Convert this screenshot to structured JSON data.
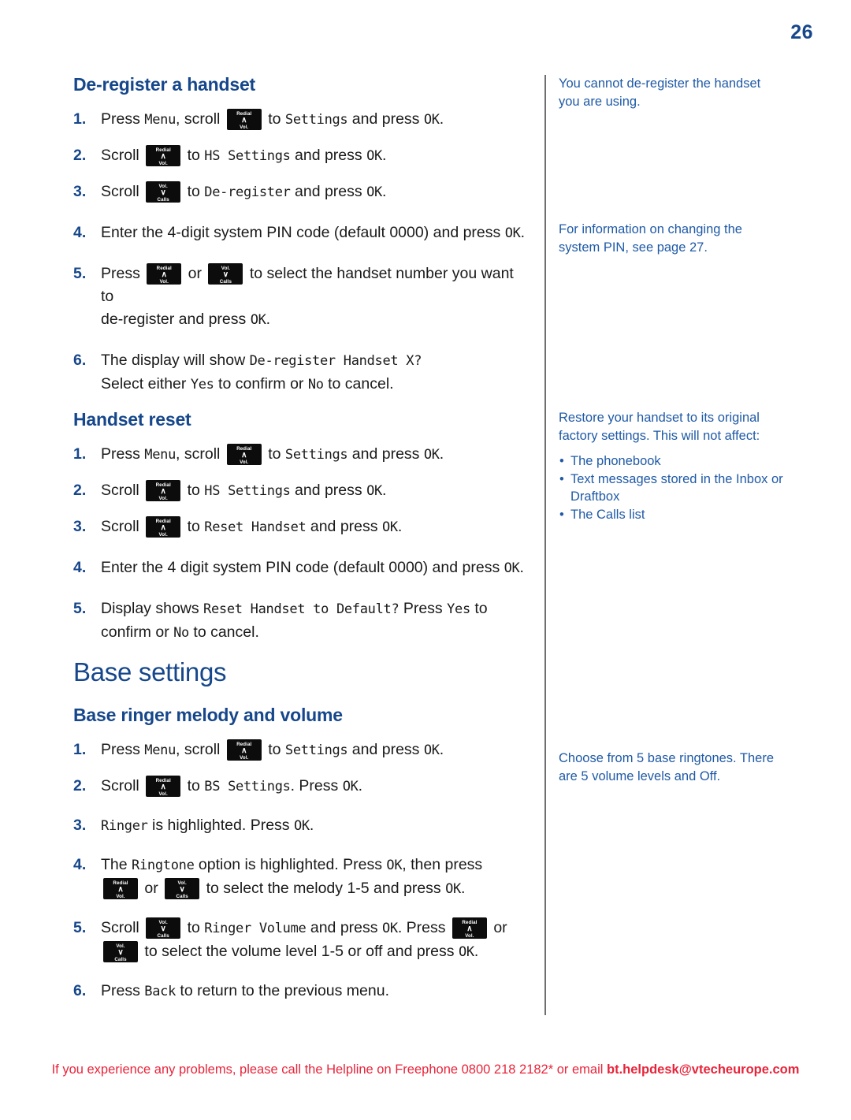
{
  "page": {
    "number": "26",
    "accent_blue": "#16478b",
    "note_blue": "#1f5aa6",
    "footer_red": "#e8243a"
  },
  "keys": {
    "up": {
      "top": "Redial",
      "arrow": "∧",
      "bottom": "Vol."
    },
    "down": {
      "top": "Vol.",
      "arrow": "∨",
      "bottom": "Calls"
    }
  },
  "sections": {
    "deregister": {
      "heading": "De-register a handset",
      "steps": {
        "s1": {
          "num": "1.",
          "a": "Press ",
          "m1": "Menu",
          "b": ", scroll ",
          "c": " to ",
          "m2": "Settings",
          "d": " and press ",
          "m3": "OK",
          "e": "."
        },
        "s2": {
          "num": "2.",
          "a": "Scroll ",
          "c": " to ",
          "m2": "HS Settings",
          "d": " and press ",
          "m3": "OK",
          "e": "."
        },
        "s3": {
          "num": "3.",
          "a": "Scroll ",
          "c": " to ",
          "m2": "De-register",
          "d": " and press ",
          "m3": "OK",
          "e": "."
        },
        "s4": {
          "num": "4.",
          "a": "Enter the 4-digit system PIN code (default 0000) and press ",
          "m3": "OK",
          "e": "."
        },
        "s5": {
          "num": "5.",
          "a": "Press ",
          "b": " or ",
          "c": " to select the handset number you want to",
          "line2a": "de-register and press ",
          "m3": "OK",
          "e": "."
        },
        "s6": {
          "num": "6.",
          "a": "The display will show ",
          "m1": "De-register Handset X?",
          "line2a": "Select either ",
          "m2": "Yes",
          "line2b": " to confirm or ",
          "m3": "No",
          "line2c": " to cancel."
        }
      },
      "note": "You cannot de-register the handset you are using.",
      "note2": "For information on changing the system PIN, see page 27."
    },
    "handset_reset": {
      "heading": "Handset reset",
      "steps": {
        "s1": {
          "num": "1.",
          "a": "Press ",
          "m1": "Menu",
          "b": ", scroll ",
          "c": " to ",
          "m2": "Settings",
          "d": " and press ",
          "m3": "OK",
          "e": "."
        },
        "s2": {
          "num": "2.",
          "a": "Scroll ",
          "c": " to ",
          "m2": "HS Settings",
          "d": " and press ",
          "m3": "OK",
          "e": "."
        },
        "s3": {
          "num": "3.",
          "a": "Scroll ",
          "c": " to ",
          "m2": "Reset Handset",
          "d": " and press ",
          "m3": "OK",
          "e": "."
        },
        "s4": {
          "num": "4.",
          "a": "Enter the 4 digit system PIN code (default 0000) and press ",
          "m3": "OK",
          "e": "."
        },
        "s5": {
          "num": "5.",
          "a": "Display shows ",
          "m1": "Reset Handset to Default?",
          "b": " Press ",
          "m2": "Yes",
          "c": " to",
          "line2a": "confirm or ",
          "m3": "No",
          "line2b": " to cancel."
        }
      },
      "note_intro": "Restore your handset to its original factory settings. This will not affect:",
      "note_items": [
        "The phonebook",
        "Text messages stored in the Inbox or Draftbox",
        "The Calls list"
      ]
    },
    "base_settings": {
      "heading": "Base settings"
    },
    "base_ringer": {
      "heading": "Base ringer melody and volume",
      "steps": {
        "s1": {
          "num": "1.",
          "a": "Press ",
          "m1": "Menu",
          "b": ", scroll ",
          "c": " to ",
          "m2": "Settings",
          "d": " and press ",
          "m3": "OK",
          "e": "."
        },
        "s2": {
          "num": "2.",
          "a": "Scroll ",
          "c": " to ",
          "m2": "BS Settings",
          "d": ". Press ",
          "m3": "OK",
          "e": "."
        },
        "s3": {
          "num": "3.",
          "m1": "Ringer",
          "a": " is highlighted. Press ",
          "m3": "OK",
          "e": "."
        },
        "s4": {
          "num": "4.",
          "a": "The ",
          "m1": "Ringtone",
          "b": " option is highlighted. Press ",
          "m2": "OK",
          "c": ", then press",
          "line2b": " or ",
          "line2c": " to select the melody 1-5 and press ",
          "m3": "OK",
          "e": "."
        },
        "s5": {
          "num": "5.",
          "a": "Scroll ",
          "b": " to ",
          "m1": "Ringer Volume",
          "c": " and press ",
          "m2": "OK",
          "d": ". Press ",
          "e": " or",
          "line2b": " to select the volume level  1-5 or off and press ",
          "m3": "OK",
          "f": "."
        },
        "s6": {
          "num": "6.",
          "a": "Press ",
          "m1": "Back",
          "b": " to return to the previous menu."
        }
      },
      "note": "Choose from 5 base ringtones. There are 5 volume levels and Off."
    }
  },
  "footer": {
    "text_before": "If you experience any problems, please call the Helpline on Freephone 0800 218 2182* or email ",
    "email": "bt.helpdesk@vtecheurope.com"
  }
}
